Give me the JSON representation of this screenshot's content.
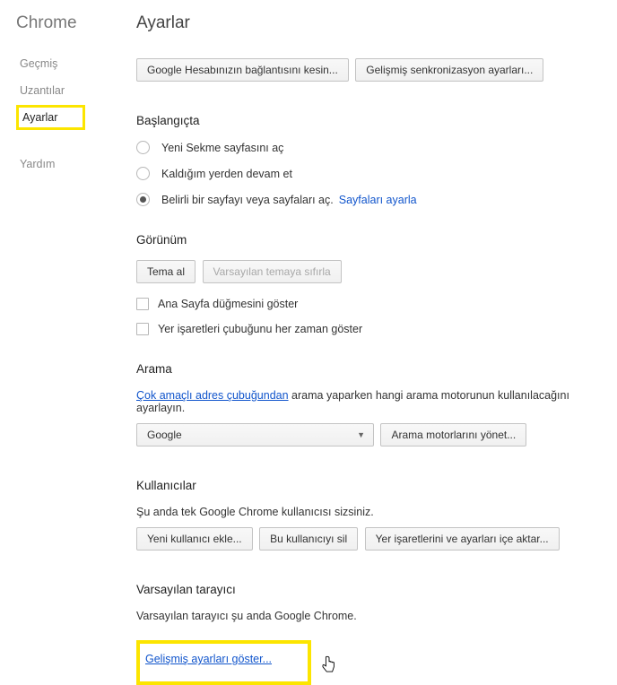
{
  "sidebar": {
    "brand": "Chrome",
    "items": [
      {
        "label": "Geçmiş"
      },
      {
        "label": "Uzantılar"
      },
      {
        "label": "Ayarlar"
      },
      {
        "label": "Yardım"
      }
    ]
  },
  "main": {
    "title": "Ayarlar"
  },
  "signin": {
    "disconnect_btn": "Google Hesabınızın bağlantısını kesin...",
    "sync_btn": "Gelişmiş senkronizasyon ayarları..."
  },
  "startup": {
    "heading": "Başlangıçta",
    "opt_newtab": "Yeni Sekme sayfasını aç",
    "opt_continue": "Kaldığım yerden devam et",
    "opt_specific": "Belirli bir sayfayı veya sayfaları aç.",
    "set_pages_link": "Sayfaları ayarla"
  },
  "appearance": {
    "heading": "Görünüm",
    "get_themes_btn": "Tema al",
    "reset_theme_btn": "Varsayılan temaya sıfırla",
    "show_home_chk": "Ana Sayfa düğmesini göster",
    "show_bookmarks_chk": "Yer işaretleri çubuğunu her zaman göster"
  },
  "search": {
    "heading": "Arama",
    "omnibox_link": "Çok amaçlı adres çubuğundan",
    "desc_rest": " arama yaparken hangi arama motorunun kullanılacağını ayarlayın.",
    "selected_engine": "Google",
    "manage_btn": "Arama motorlarını yönet..."
  },
  "users": {
    "heading": "Kullanıcılar",
    "desc": "Şu anda tek Google Chrome kullanıcısı sizsiniz.",
    "add_btn": "Yeni kullanıcı ekle...",
    "delete_btn": "Bu kullanıcıyı sil",
    "import_btn": "Yer işaretlerini ve ayarları içe aktar..."
  },
  "default_browser": {
    "heading": "Varsayılan tarayıcı",
    "desc": "Varsayılan tarayıcı şu anda Google Chrome."
  },
  "advanced_link": "Gelişmiş ayarları göster..."
}
